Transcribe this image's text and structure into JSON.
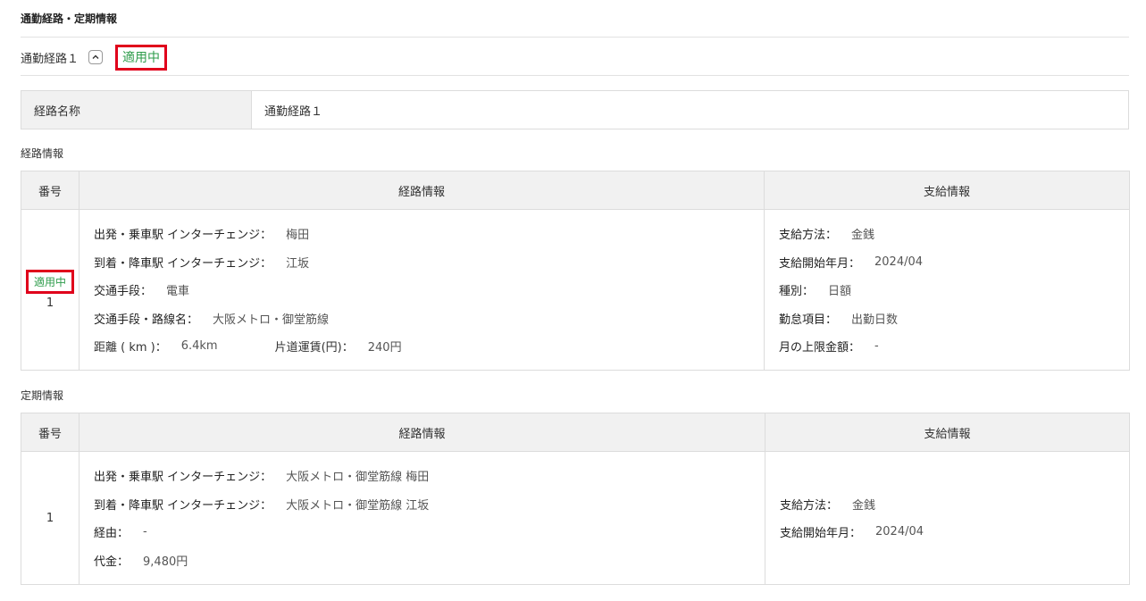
{
  "section": {
    "title": "通勤経路・定期情報"
  },
  "route": {
    "name": "通勤経路１",
    "toggle_icon": "chevron-up-icon",
    "status": "適用中",
    "name_label": "経路名称",
    "name_value": "通勤経路１"
  },
  "route_info": {
    "title": "経路情報",
    "headers": {
      "num": "番号",
      "route": "経路情報",
      "payment": "支給情報"
    },
    "row": {
      "status": "適用中",
      "num": "1",
      "departure_label": "出発・乗車駅 インターチェンジ：",
      "departure_value": "梅田",
      "arrival_label": "到着・降車駅 インターチェンジ：",
      "arrival_value": "江坂",
      "transport_label": "交通手段：",
      "transport_value": "電車",
      "line_label": "交通手段・路線名：",
      "line_value": "大阪メトロ・御堂筋線",
      "distance_label": "距離 ( km )：",
      "distance_value": "6.4km",
      "fare_label": "片道運賃(円)：",
      "fare_value": "240円",
      "method_label": "支給方法：",
      "method_value": "金銭",
      "start_label": "支給開始年月：",
      "start_value": "2024/04",
      "type_label": "種別：",
      "type_value": "日額",
      "item_label": "勤怠項目：",
      "item_value": "出勤日数",
      "limit_label": "月の上限金額：",
      "limit_value": "-"
    }
  },
  "pass_info": {
    "title": "定期情報",
    "headers": {
      "num": "番号",
      "route": "経路情報",
      "payment": "支給情報"
    },
    "row": {
      "num": "1",
      "departure_label": "出発・乗車駅 インターチェンジ：",
      "departure_value": "大阪メトロ・御堂筋線 梅田",
      "arrival_label": "到着・降車駅 インターチェンジ：",
      "arrival_value": "大阪メトロ・御堂筋線 江坂",
      "via_label": "経由：",
      "via_value": "-",
      "price_label": "代金：",
      "price_value": "9,480円",
      "method_label": "支給方法：",
      "method_value": "金銭",
      "start_label": "支給開始年月：",
      "start_value": "2024/04"
    }
  },
  "colors": {
    "status_green": "#2e9c4b",
    "highlight_red": "#e0001b",
    "header_bg": "#f1f1f1",
    "border": "#dcdcdc"
  }
}
